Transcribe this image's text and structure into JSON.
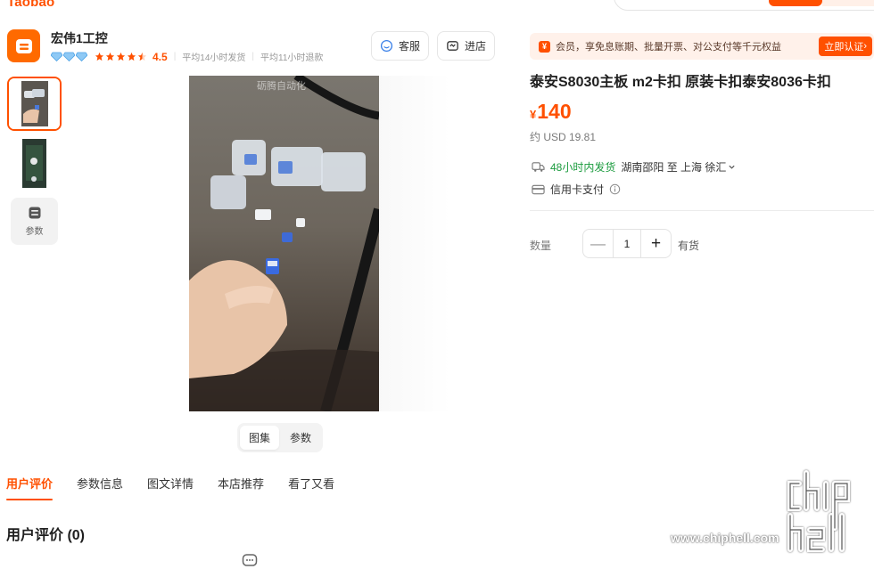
{
  "header": {
    "logo_text": "Taobao"
  },
  "shop": {
    "name": "宏伟1工控",
    "rating": "4.5",
    "ship_time": "平均14小时发货",
    "refund_time": "平均11小时退款",
    "service_label": "客服",
    "store_label": "进店",
    "logo_icon": "shop-bag-icon"
  },
  "gallery": {
    "switch_images": "图集",
    "switch_params": "参数",
    "params_thumb_label": "参数",
    "image_watermark": "砺腾自动化"
  },
  "tabs": [
    "用户评价",
    "参数信息",
    "图文详情",
    "本店推荐",
    "看了又看"
  ],
  "reviews": {
    "title": "用户评价 (0)"
  },
  "product": {
    "member_banner": "会员，享免息账期、批量开票、对公支付等千元权益",
    "member_badge": "¥",
    "member_cta": "立即认证",
    "title": "泰安S8030主板 m2卡扣 原装卡扣泰安8036卡扣",
    "price_symbol": "¥",
    "price": "140",
    "usd_price": "约 USD 19.81",
    "ship_promise": "48小时内发货",
    "ship_route": "湖南邵阳 至 上海 徐汇",
    "payment": "信用卡支付",
    "qty_label": "数量",
    "qty_value": "1",
    "stock": "有货"
  },
  "watermark": {
    "site": "www.chiphell.com"
  },
  "colors": {
    "accent": "#ff5000",
    "ship_green": "#1a9b3d"
  }
}
